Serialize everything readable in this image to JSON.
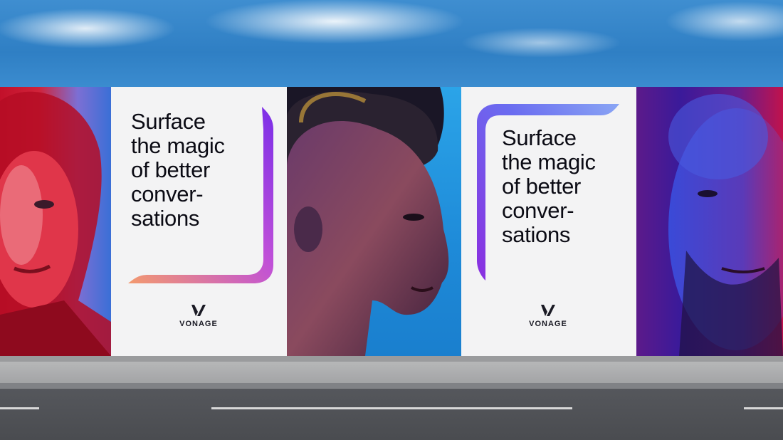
{
  "poster_a": {
    "headline_lines": [
      "Surface",
      "the magic",
      "of better",
      "conver-",
      "sations"
    ],
    "brand": "VONAGE"
  },
  "poster_b": {
    "headline_lines": [
      "Surface",
      "the magic",
      "of better",
      "conver-",
      "sations"
    ],
    "brand": "VONAGE"
  },
  "colors": {
    "accent_purple": "#8a3cf0",
    "accent_coral": "#ef8a6a",
    "poster_bg": "#f3f3f4"
  }
}
